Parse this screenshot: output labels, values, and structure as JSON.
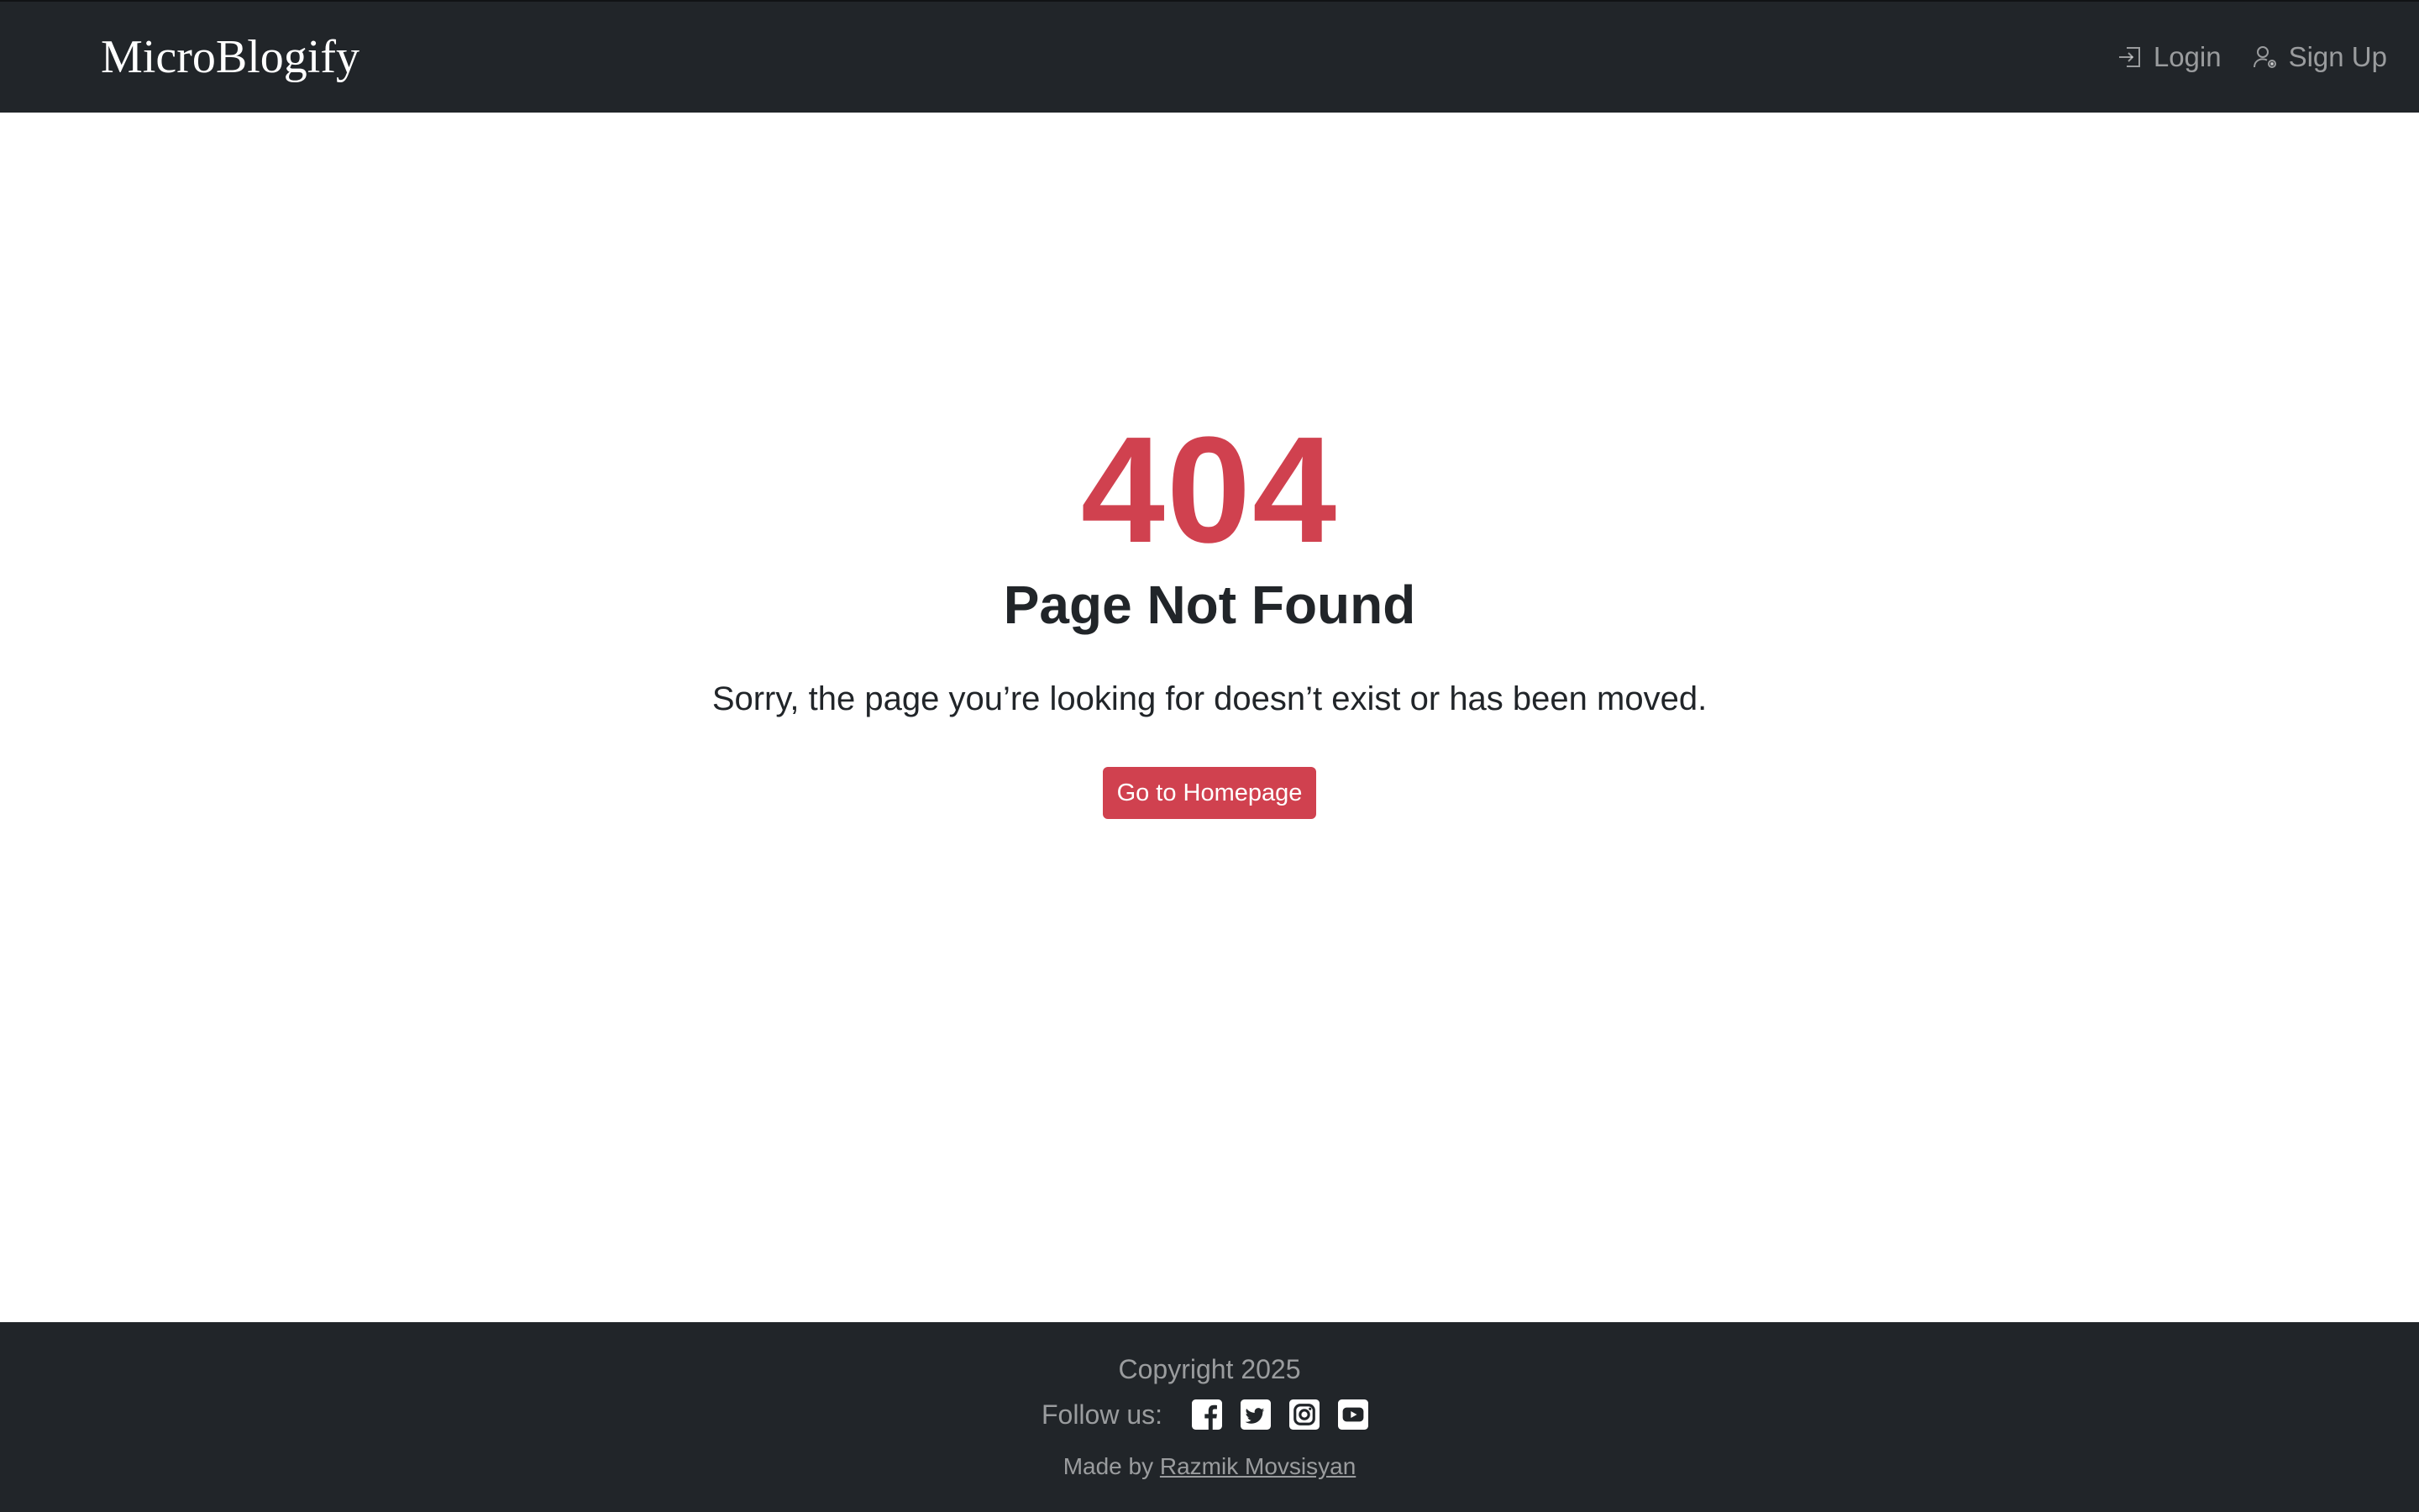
{
  "header": {
    "brand": "MicroBlogify",
    "login_label": "Login",
    "signup_label": "Sign Up",
    "login_icon": "login-arrow-icon",
    "signup_icon": "person-gear-icon"
  },
  "main": {
    "code": "404",
    "title": "Page Not Found",
    "message": "Sorry, the page you’re looking for doesn’t exist or has been moved.",
    "button_label": "Go to Homepage"
  },
  "footer": {
    "copyright": "Copyright 2025",
    "follow_label": "Follow us:",
    "social": [
      "facebook-icon",
      "twitter-icon",
      "instagram-icon",
      "youtube-icon"
    ],
    "made_by_prefix": "Made by",
    "author": "Razmik Movsisyan"
  },
  "colors": {
    "navbar_bg": "#212529",
    "accent_red": "#d0414f",
    "text_dark": "#212529",
    "muted": "rgba(255,255,255,0.55)"
  }
}
